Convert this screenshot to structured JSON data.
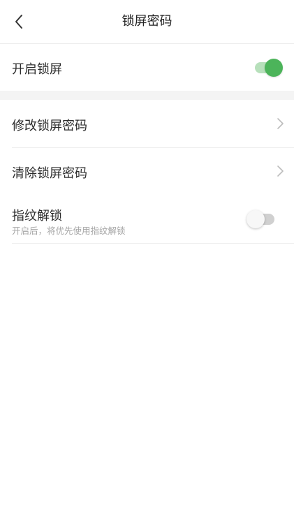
{
  "header": {
    "title": "锁屏密码",
    "back_icon": "chevron-left-icon"
  },
  "settings": {
    "enable_lock": {
      "label": "开启锁屏",
      "enabled": true
    },
    "change_password": {
      "label": "修改锁屏密码",
      "icon": "chevron-right-icon"
    },
    "clear_password": {
      "label": "清除锁屏密码",
      "icon": "chevron-right-icon"
    },
    "fingerprint": {
      "label": "指纹解锁",
      "subtitle": "开启后，将优先使用指纹解锁",
      "enabled": false
    }
  },
  "colors": {
    "accent": "#4cb45a",
    "accent_track": "#b7e0bb",
    "off_track": "#d0d0d0",
    "divider": "#eeeeee",
    "section_gap": "#f4f4f4"
  }
}
